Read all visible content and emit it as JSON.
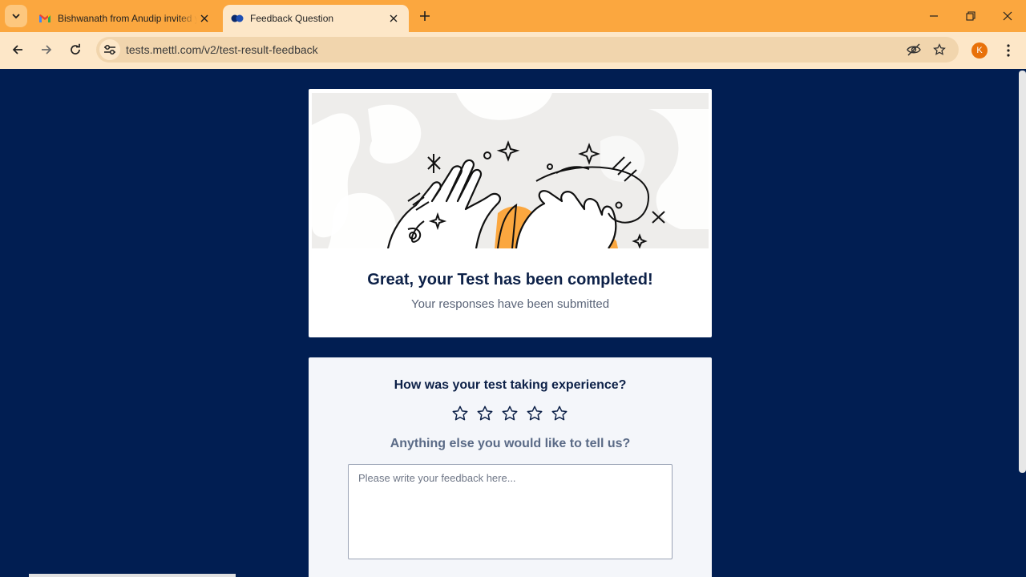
{
  "browser": {
    "tabs": [
      {
        "title": "Bishwanath from Anudip invited you",
        "favicon": "gmail-icon",
        "active": false
      },
      {
        "title": "Feedback Question",
        "favicon": "mettl-icon",
        "active": true
      }
    ],
    "url": "tests.mettl.com/v2/test-result-feedback",
    "profile_initial": "K",
    "theme_color": "#fba73f"
  },
  "completion": {
    "heading": "Great, your Test has been completed!",
    "subheading": "Your responses have been submitted"
  },
  "feedback": {
    "rating_question": "How was your test taking experience?",
    "rating_max": 5,
    "rating_value": 0,
    "comment_question": "Anything else you would like to tell us?",
    "comment_placeholder": "Please write your feedback here...",
    "comment_value": ""
  }
}
